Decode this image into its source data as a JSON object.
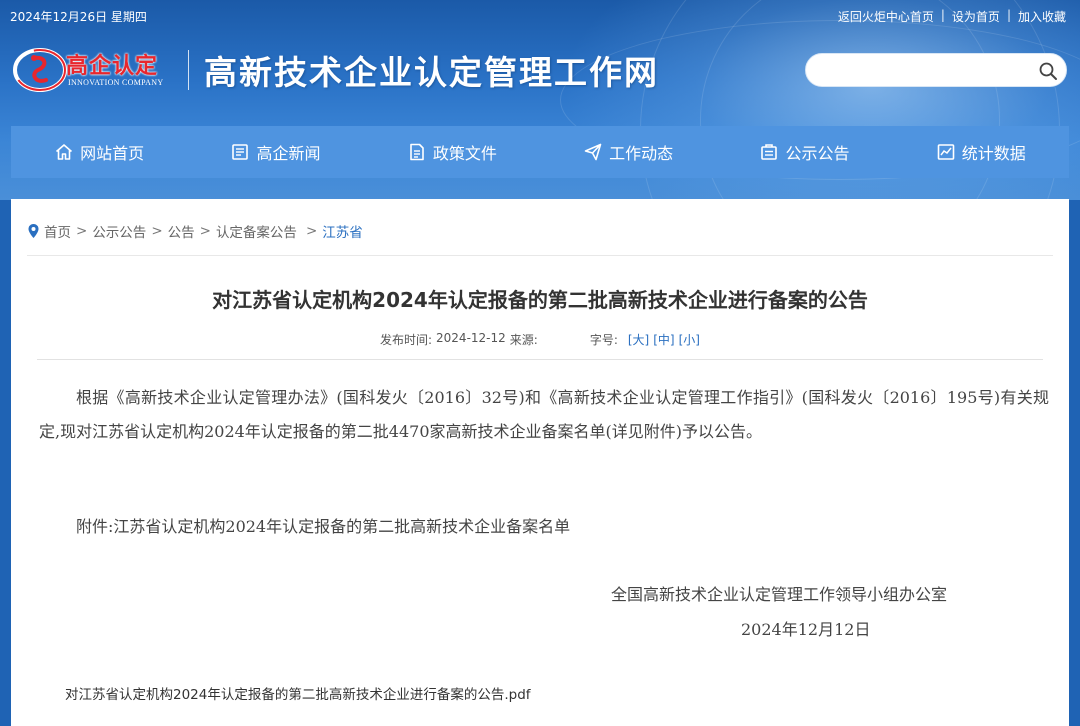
{
  "topbar": {
    "date": "2024年12月26日 星期四",
    "links": [
      "返回火炬中心首页",
      "设为首页",
      "加入收藏"
    ],
    "separator": "|"
  },
  "logo": {
    "name": "高企认定",
    "en": "INNOVATION COMPANY",
    "brand_color": "#e8262d"
  },
  "site_title": "高新技术企业认定管理工作网",
  "search": {
    "placeholder": ""
  },
  "nav": {
    "items": [
      {
        "label": "网站首页",
        "icon": "home-icon"
      },
      {
        "label": "高企新闻",
        "icon": "news-icon"
      },
      {
        "label": "政策文件",
        "icon": "document-icon"
      },
      {
        "label": "工作动态",
        "icon": "paper-plane-icon"
      },
      {
        "label": "公示公告",
        "icon": "announcement-icon"
      },
      {
        "label": "统计数据",
        "icon": "chart-icon"
      }
    ],
    "color": "#4f94e0"
  },
  "breadcrumb": {
    "items": [
      "首页",
      "公示公告",
      "公告",
      "认定备案公告",
      "江苏省"
    ],
    "arrow": ">"
  },
  "article": {
    "title": "对江苏省认定机构2024年认定报备的第二批高新技术企业进行备案的公告",
    "publish_label": "发布时间:",
    "publish_date": "2024-12-12",
    "source_label": "来源:",
    "font_label": "字号:",
    "size_large": "[大]",
    "size_medium": "[中]",
    "size_small": "[小]",
    "body": "根据《高新技术企业认定管理办法》(国科发火〔2016〕32号)和《高新技术企业认定管理工作指引》(国科发火〔2016〕195号)有关规定,现对江苏省认定机构2024年认定报备的第二批4470家高新技术企业备案名单(详见附件)予以公告。",
    "attachment_text": "附件:江苏省认定机构2024年认定报备的第二批高新技术企业备案名单",
    "signature_org": "全国高新技术企业认定管理工作领导小组办公室",
    "signature_date": "2024年12月12日",
    "pdf_name": "对江苏省认定机构2024年认定报备的第二批高新技术企业进行备案的公告.pdf"
  }
}
